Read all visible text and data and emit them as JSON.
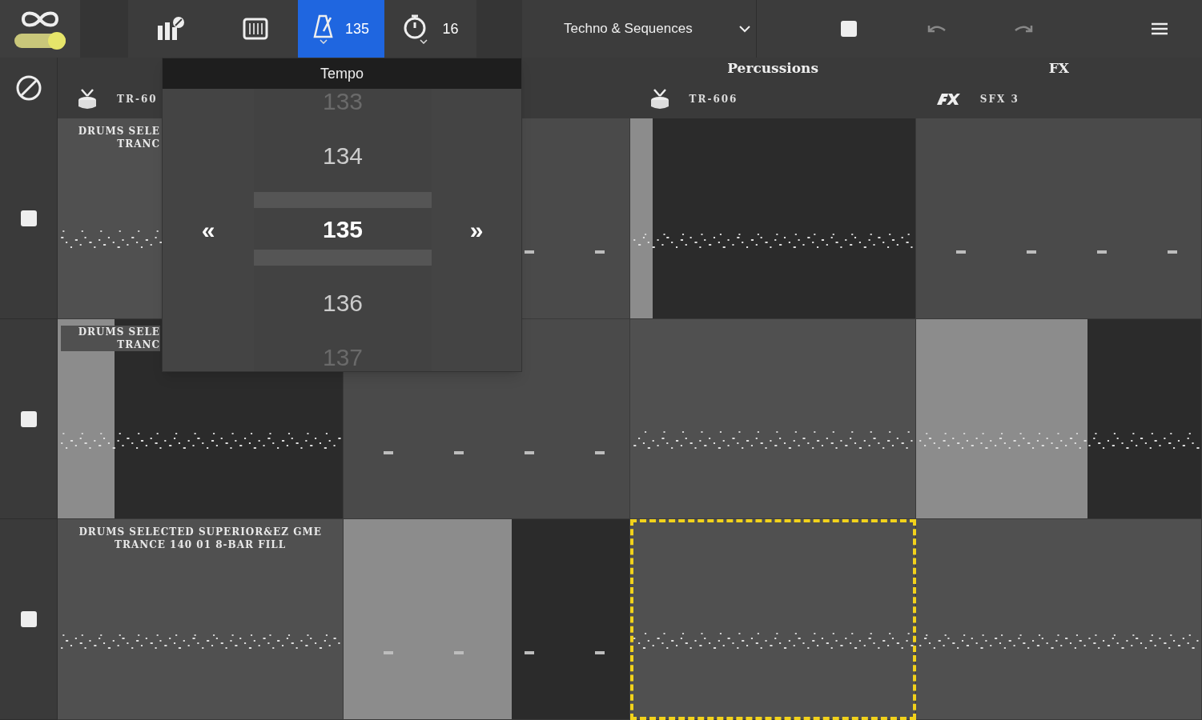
{
  "toolbar": {
    "loop_enabled": true,
    "tempo_button": {
      "value": "135",
      "selected": true
    },
    "timer_button": {
      "value": "16",
      "selected": false
    },
    "preset": "Techno & Sequences"
  },
  "tempo_popup": {
    "title": "Tempo",
    "prev": "«",
    "next": "»",
    "values": [
      {
        "label": "133",
        "selected": false
      },
      {
        "label": "134",
        "selected": false
      },
      {
        "label": "135",
        "selected": true
      },
      {
        "label": "136",
        "selected": false
      },
      {
        "label": "137",
        "selected": false
      }
    ]
  },
  "columns": [
    {
      "instrument": "TR-60",
      "kind": "drums"
    },
    {
      "kind": "hidden"
    },
    {
      "group": "Percussions",
      "instrument": "TR-606",
      "kind": "drums"
    },
    {
      "group": "FX",
      "instrument": "SFX 3",
      "kind": "fx"
    }
  ],
  "rows": [
    {
      "cells": [
        {
          "kind": "clip",
          "title": [
            "DRUMS SELE",
            "TRANC"
          ],
          "selected": false
        },
        {
          "kind": "empty",
          "selected": false
        },
        {
          "kind": "clip",
          "level": 0.08,
          "selected": false
        },
        {
          "kind": "empty",
          "selected": false
        }
      ]
    },
    {
      "cells": [
        {
          "kind": "clip",
          "title": [
            "DRUMS SELE",
            "TRANC"
          ],
          "level": 0.2,
          "selected": false
        },
        {
          "kind": "empty",
          "selected": false
        },
        {
          "kind": "clip",
          "selected": false
        },
        {
          "kind": "clip",
          "level": 0.6,
          "selected": false
        }
      ]
    },
    {
      "cells": [
        {
          "kind": "clip",
          "title": [
            "DRUMS SELECTED SUPERIOR&EZ GME",
            "TRANCE 140 01 8-BAR FILL"
          ],
          "selected": false
        },
        {
          "kind": "empty",
          "level": 0.59,
          "selected": false
        },
        {
          "kind": "clip",
          "selected": true
        },
        {
          "kind": "clip",
          "selected": false
        }
      ]
    }
  ]
}
